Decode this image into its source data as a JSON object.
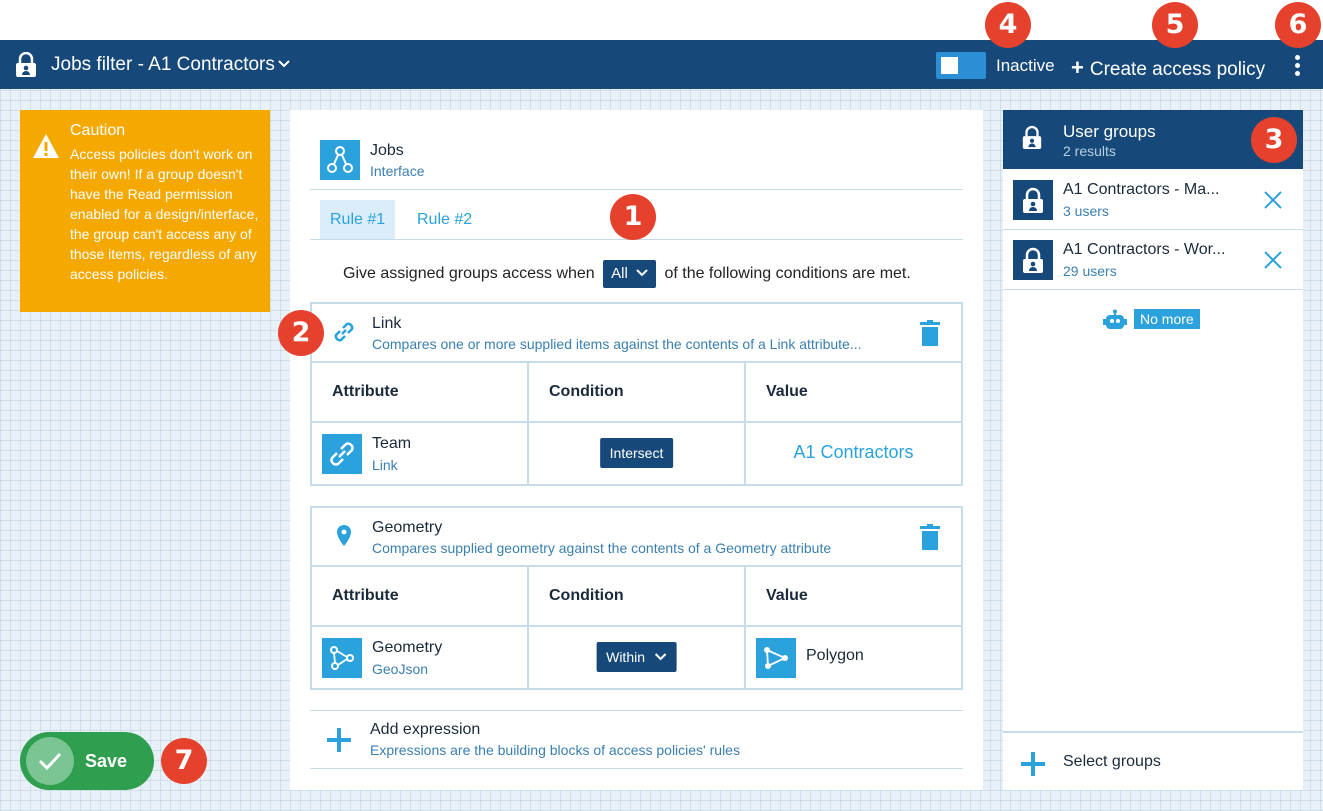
{
  "header": {
    "title": "Jobs filter - A1 Contractors",
    "status_label": "Inactive",
    "create_label": "Create access policy",
    "colors": {
      "bar": "#16497a",
      "accent": "#2ba2dc"
    }
  },
  "annotations": [
    "1",
    "2",
    "3",
    "4",
    "5",
    "6",
    "7"
  ],
  "caution": {
    "title": "Caution",
    "text": "Access policies don't work on their own! If a group doesn't have the Read permission enabled for a design/interface, the group can't access any of those items, regardless of any access policies."
  },
  "interface": {
    "name": "Jobs",
    "type": "Interface"
  },
  "rules": {
    "tabs": [
      {
        "label": "Rule #1",
        "active": true
      },
      {
        "label": "Rule #2",
        "active": false
      }
    ],
    "condition_prefix": "Give assigned groups access when",
    "condition_selector": "All",
    "condition_suffix": "of the following conditions are met."
  },
  "expressions": [
    {
      "name": "Link",
      "description": "Compares one or more supplied items against the contents of a Link attribute...",
      "headers": [
        "Attribute",
        "Condition",
        "Value"
      ],
      "attribute_name": "Team",
      "attribute_type": "Link",
      "condition": "Intersect",
      "value": "A1 Contractors"
    },
    {
      "name": "Geometry",
      "description": "Compares supplied geometry against the contents of a Geometry attribute",
      "headers": [
        "Attribute",
        "Condition",
        "Value"
      ],
      "attribute_name": "Geometry",
      "attribute_type": "GeoJson",
      "condition": "Within",
      "value": "Polygon"
    }
  ],
  "add_expression": {
    "title": "Add expression",
    "description": "Expressions are the building blocks of access policies' rules"
  },
  "user_groups": {
    "title": "User groups",
    "subtitle": "2 results",
    "items": [
      {
        "name": "A1 Contractors - Ma...",
        "users": "3 users"
      },
      {
        "name": "A1 Contractors - Wor...",
        "users": "29 users"
      }
    ],
    "no_more": "No more",
    "select_label": "Select groups"
  },
  "save": {
    "label": "Save"
  }
}
